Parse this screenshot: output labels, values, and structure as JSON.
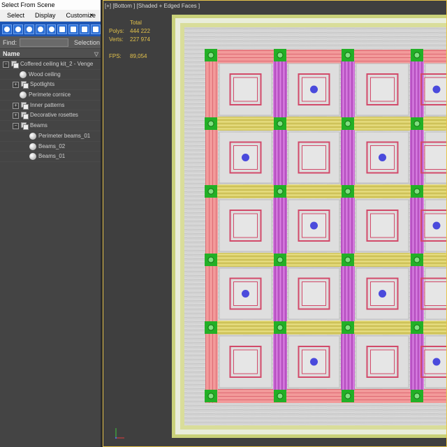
{
  "window": {
    "title": "Select From Scene"
  },
  "menu": {
    "items": [
      "Select",
      "Display",
      "Customize"
    ],
    "close_glyph": "×"
  },
  "toolbar": {
    "buttons": [
      "display-geometry-icon",
      "display-shapes-icon",
      "display-lights-icon",
      "display-cameras-icon",
      "display-helpers-icon",
      "display-spacewarps-icon",
      "display-groups-icon",
      "display-xrefs-icon",
      "display-bones-icon"
    ]
  },
  "find": {
    "label": "Find:",
    "value": "",
    "selection_label": "Selection"
  },
  "column": {
    "name_header": "Name",
    "filter_glyph": "▽"
  },
  "tree": [
    {
      "label": "Coffered ceiling kit_2 - Venge",
      "depth": 0,
      "kind": "layer",
      "expander": "−"
    },
    {
      "label": "Wood ceiling",
      "depth": 1,
      "kind": "object",
      "expander": ""
    },
    {
      "label": "Spotlights",
      "depth": 1,
      "kind": "layer",
      "expander": "+"
    },
    {
      "label": "Perimete cornice",
      "depth": 1,
      "kind": "object",
      "expander": ""
    },
    {
      "label": "Inner patterns",
      "depth": 1,
      "kind": "layer",
      "expander": "+"
    },
    {
      "label": "Decorative rosettes",
      "depth": 1,
      "kind": "layer",
      "expander": "+"
    },
    {
      "label": "Beams",
      "depth": 1,
      "kind": "layer",
      "expander": "−"
    },
    {
      "label": "Perimeter beams_01",
      "depth": 2,
      "kind": "object",
      "expander": ""
    },
    {
      "label": "Beams_02",
      "depth": 2,
      "kind": "object",
      "expander": ""
    },
    {
      "label": "Beams_01",
      "depth": 2,
      "kind": "object",
      "expander": ""
    }
  ],
  "viewport": {
    "label": "[+] [Bottom ] [Shaded + Edged Faces ]",
    "stats": {
      "total_header": "Total",
      "polys_label": "Polys:",
      "polys_value": "444 222",
      "verts_label": "Verts:",
      "verts_value": "227 974",
      "fps_label": "FPS:",
      "fps_value": "89,054"
    },
    "colors": {
      "frame_border": "#e6c34a",
      "cornice": "#c9d17a",
      "wood_ceiling": "#cfcfcf",
      "perimeter_beam": "#f08a8a",
      "vertical_beam": "#c860c8",
      "horizontal_beam": "#d7cf6a",
      "junction_block": "#22b026",
      "rosette_frame": "#d24a6a",
      "spotlight": "#4a4adc"
    }
  }
}
